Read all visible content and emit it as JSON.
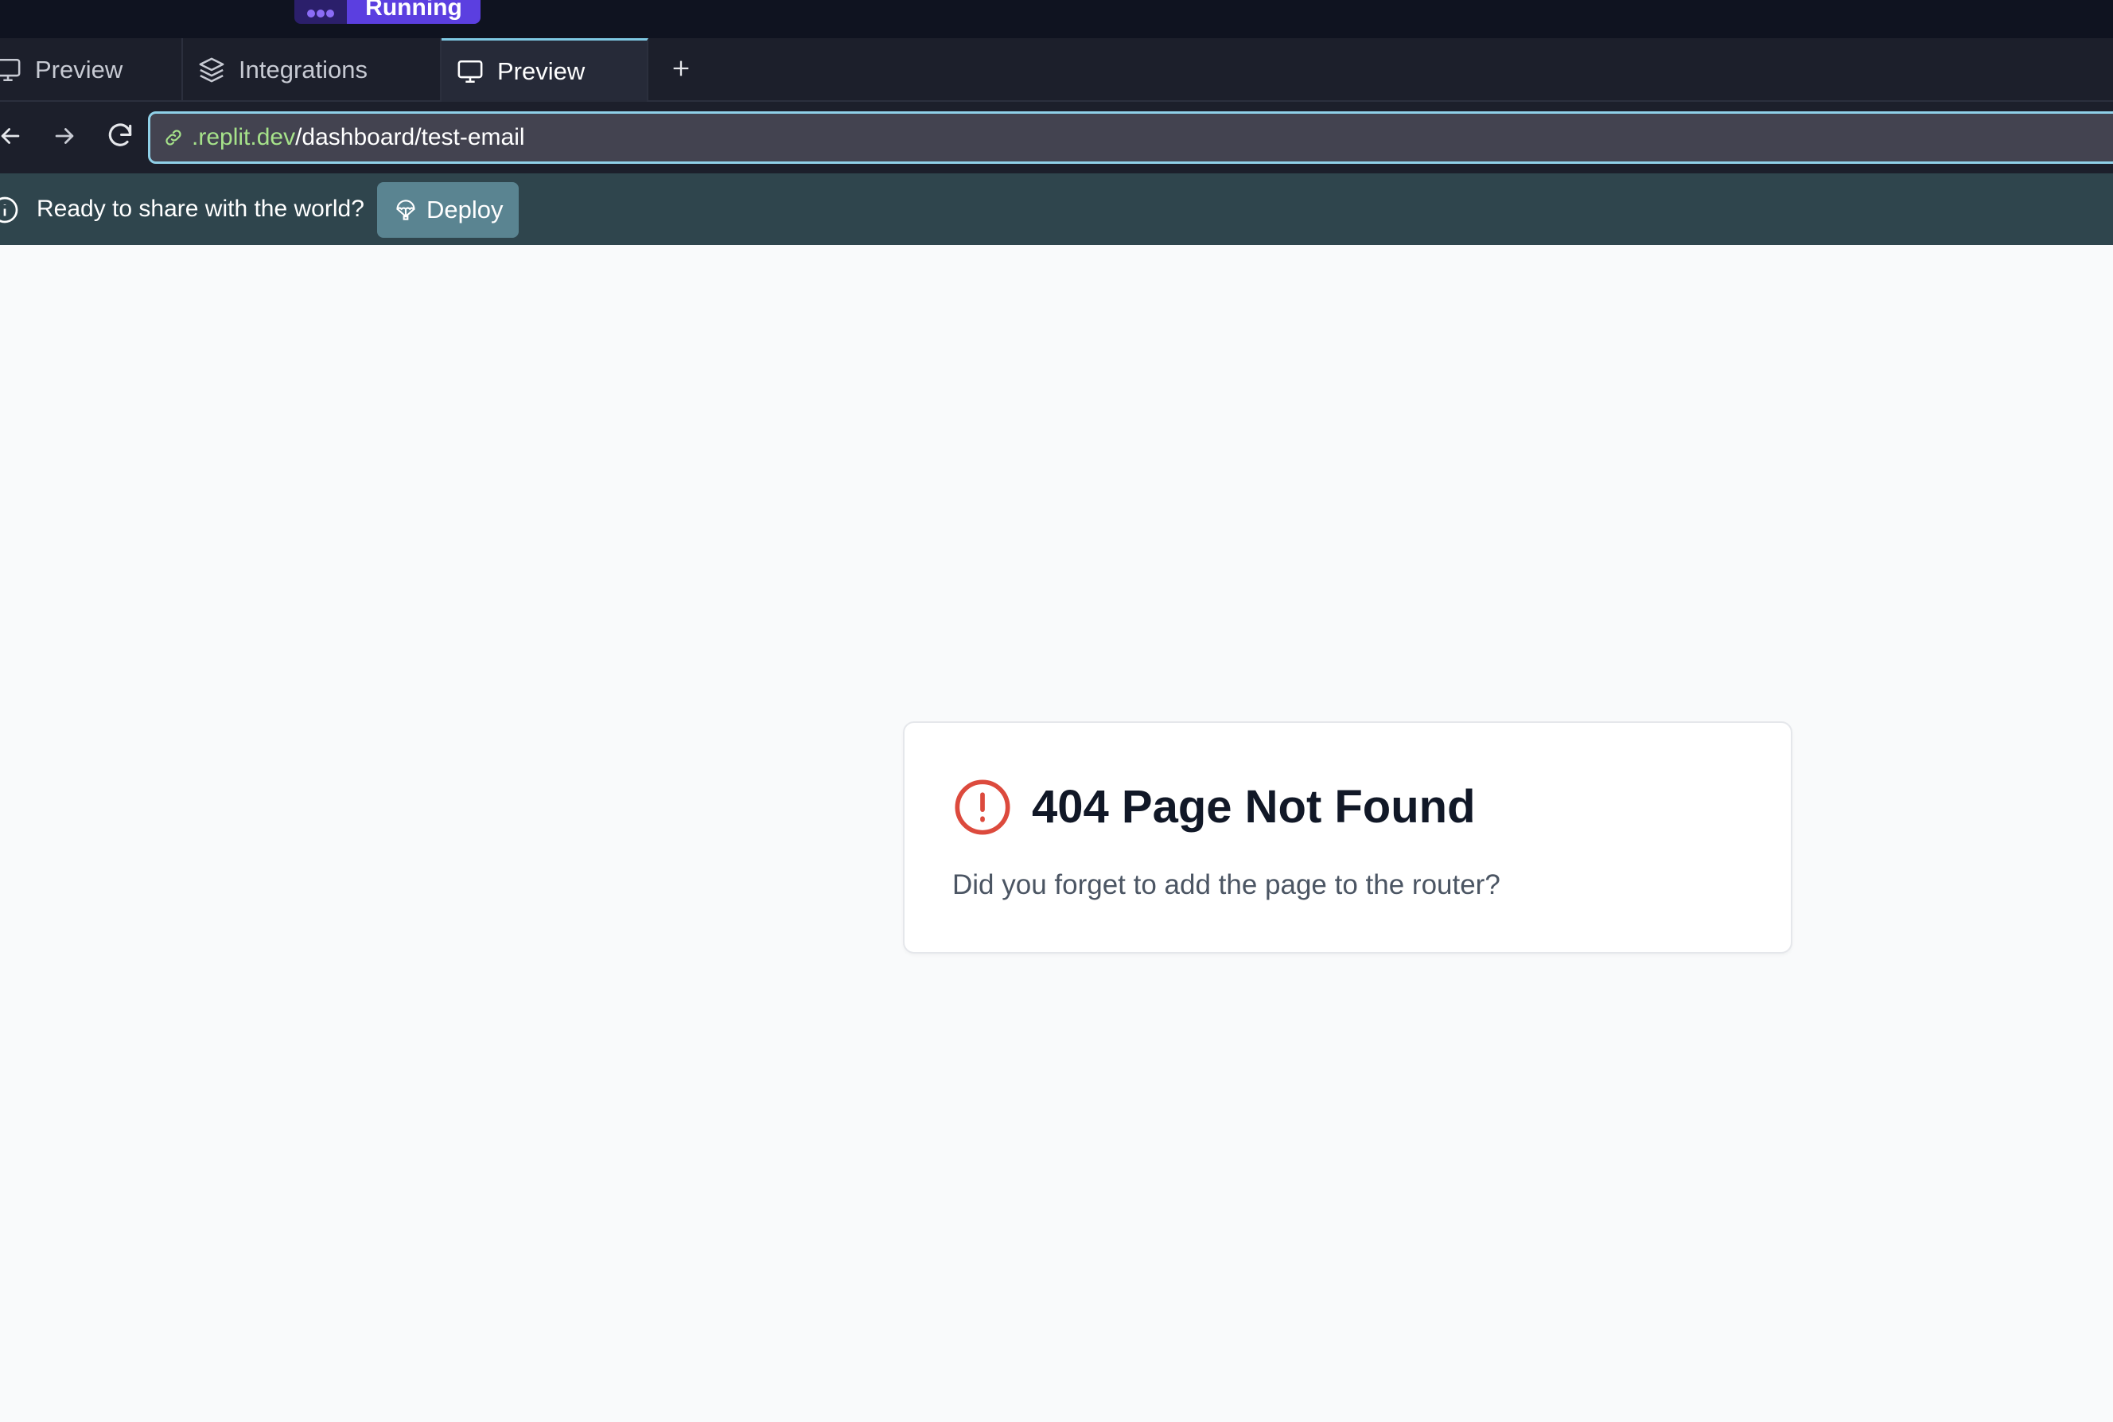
{
  "status_badge": {
    "label": "Running",
    "icon": "running-dots-icon"
  },
  "tabs": [
    {
      "label": "Preview",
      "icon": "monitor-icon",
      "active": false
    },
    {
      "label": "Integrations",
      "icon": "layers-icon",
      "active": false
    },
    {
      "label": "Preview",
      "icon": "monitor-icon",
      "active": true
    }
  ],
  "url": {
    "domain": ".replit.dev",
    "path": "/dashboard/test-email"
  },
  "share_banner": {
    "text": "Ready to share with the world?",
    "deploy_label": "Deploy"
  },
  "not_found": {
    "title": "404 Page Not Found",
    "message": "Did you forget to add the page to the router?"
  },
  "colors": {
    "accent": "#7ec8e3",
    "domain": "#a6e28a",
    "error": "#dc4a3d",
    "deploy_bg": "#5a8491",
    "banner_bg": "#2f454d",
    "running_bg": "#5b3fe0"
  }
}
